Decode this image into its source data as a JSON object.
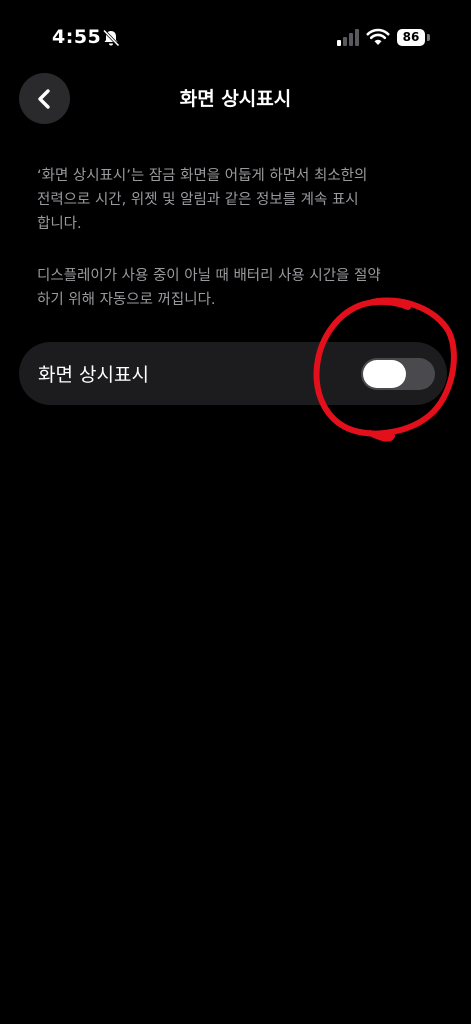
{
  "status_bar": {
    "time": "4:55",
    "battery": "86"
  },
  "header": {
    "title": "화면 상시표시"
  },
  "descriptions": [
    "‘화면 상시표시’는 잠금 화면을 어둡게 하면서 최소한의\n전력으로 시간, 위젯 및 알림과 같은 정보를 계속 표시\n합니다.",
    "디스플레이가 사용 중이 아닐 때 배터리 사용 시간을 절약\n하기 위해 자동으로 꺼집니다."
  ],
  "setting": {
    "label": "화면 상시표시",
    "enabled": false
  },
  "colors": {
    "background": "#000000",
    "row_background": "#1c1c1e",
    "secondary_text": "#9a9a9e",
    "toggle_track": "#4a4a4e",
    "annotation": "#e3101c"
  },
  "icons": {
    "bell": "bell-slash-icon",
    "signal": "cellular-signal-icon",
    "wifi": "wifi-icon",
    "back": "chevron-left-icon"
  }
}
